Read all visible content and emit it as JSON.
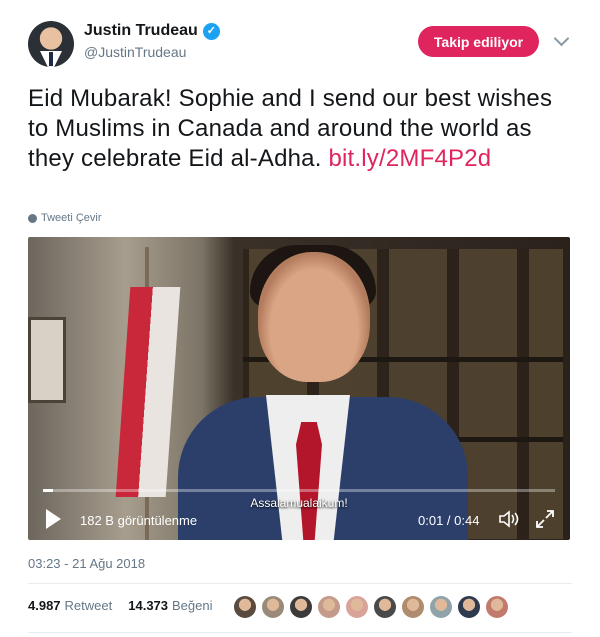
{
  "author": {
    "display_name": "Justin Trudeau",
    "handle": "@JustinTrudeau"
  },
  "follow_button_label": "Takip ediliyor",
  "tweet": {
    "text": "Eid Mubarak! Sophie and I send our best wishes to Muslims in Canada and around the world as they celebrate Eid al-Adha. ",
    "link": "bit.ly/2MF4P2d"
  },
  "translate_label": "Tweeti Çevir",
  "video": {
    "caption": "Assalamualaikum!",
    "views": "182 B görüntülenme",
    "time": "0:01 / 0:44",
    "progress": 0.02
  },
  "timestamp": "03:23 - 21 Ağu 2018",
  "stats": {
    "retweet_count": "4.987",
    "retweet_label": "Retweet",
    "like_count": "14.373",
    "like_label": "Beğeni"
  },
  "colors": {
    "accent": "#e0245e",
    "verified": "#1da1f2",
    "muted": "#657786"
  },
  "icons": [
    "verified-badge-icon",
    "chevron-down-icon",
    "globe-icon",
    "play-icon",
    "volume-icon",
    "fullscreen-icon"
  ],
  "likers": [
    "#5b4a3e",
    "#9a8a7a",
    "#3d3a3a",
    "#c49a8a",
    "#d8a49a",
    "#4a4a4a",
    "#b08c6e",
    "#8fa3a8",
    "#2f3a4f",
    "#c27a6c"
  ]
}
